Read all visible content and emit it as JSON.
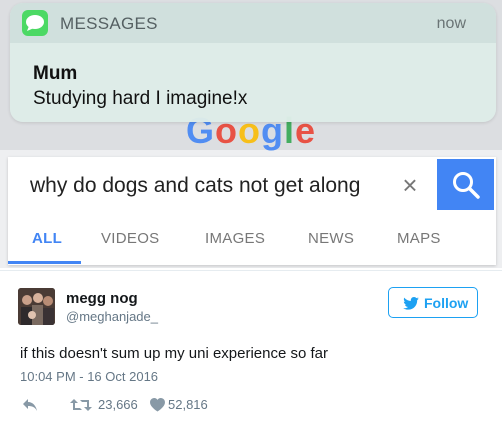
{
  "notification": {
    "app_name": "MESSAGES",
    "time": "now",
    "sender": "Mum",
    "message": "Studying hard I imagine!x",
    "app_icon": "messages-bubble-icon",
    "app_color": "#4cd964"
  },
  "google": {
    "logo_letters": [
      "G",
      "o",
      "o",
      "g",
      "l",
      "e"
    ],
    "logo_colors": [
      "#4285f4",
      "#ea4335",
      "#fbbc05",
      "#4285f4",
      "#34a853",
      "#ea4335"
    ],
    "query": "why do dogs and cats not get along",
    "clear_icon": "×",
    "accent": "#4285f4",
    "tabs": [
      {
        "label": "ALL",
        "active": true
      },
      {
        "label": "VIDEOS",
        "active": false
      },
      {
        "label": "IMAGES",
        "active": false
      },
      {
        "label": "NEWS",
        "active": false
      },
      {
        "label": "MAPS",
        "active": false
      }
    ]
  },
  "tweet": {
    "display_name": "megg nog",
    "handle": "@meghanjade_",
    "follow_label": "Follow",
    "text": "if this doesn't sum up my uni experience so far",
    "timestamp": "10:04 PM - 16 Oct 2016",
    "retweets": "23,666",
    "likes": "52,816",
    "accent": "#1da1f2"
  }
}
